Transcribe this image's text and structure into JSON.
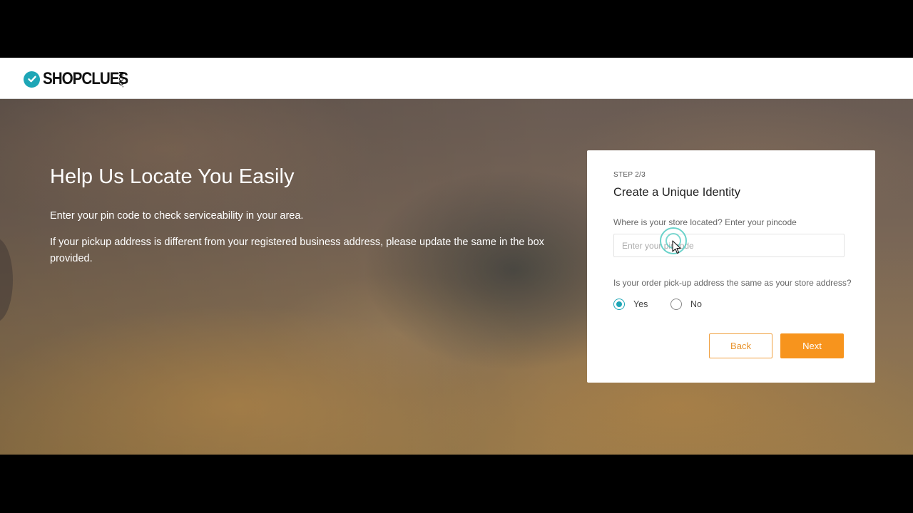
{
  "header": {
    "brand": "SHOPCLUES",
    "brand_suffix": ".COM"
  },
  "hero": {
    "title": "Help Us Locate You Easily",
    "paragraph1": "Enter your pin code to check serviceability in your area.",
    "paragraph2": "If your pickup address is different from your registered business address, please update the same in the box provided."
  },
  "form": {
    "step": "STEP 2/3",
    "title": "Create a Unique Identity",
    "pincode_label": "Where is your store located? Enter your pincode",
    "pincode_placeholder": "Enter your pincode",
    "pincode_value": "",
    "same_address_label": "Is your order pick-up address the same as your store address?",
    "options": [
      {
        "label": "Yes",
        "selected": true
      },
      {
        "label": "No",
        "selected": false
      }
    ],
    "back_label": "Back",
    "next_label": "Next"
  },
  "colors": {
    "brand_teal": "#1ea6b6",
    "accent_orange": "#f7941d"
  },
  "icons": [
    "check-circle-icon",
    "mouse-pointer-icon"
  ]
}
